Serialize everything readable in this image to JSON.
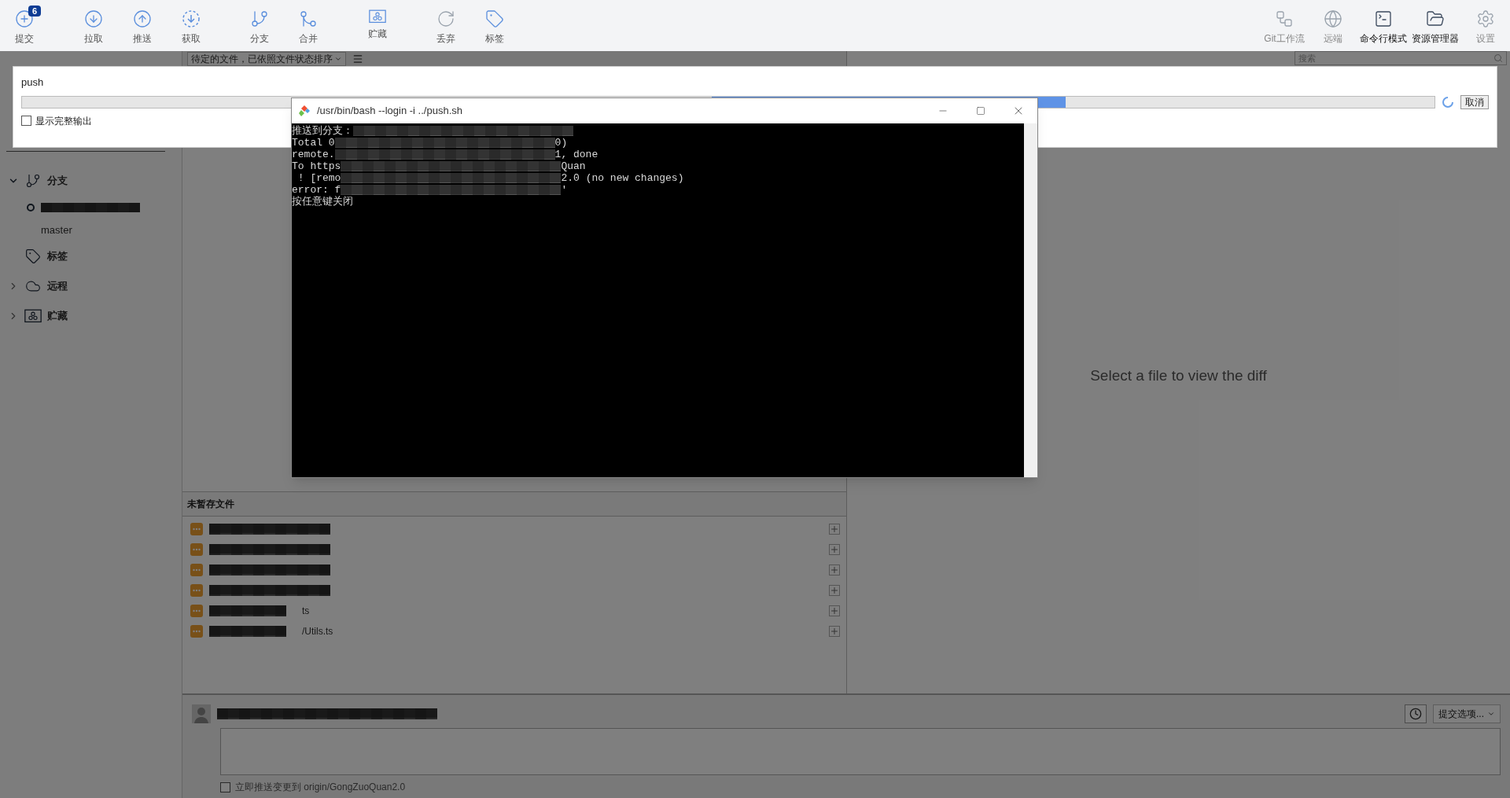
{
  "toolbar": {
    "left": [
      {
        "label": "提交",
        "badge": "6"
      },
      {
        "label": "拉取"
      },
      {
        "label": "推送"
      },
      {
        "label": "获取"
      },
      {
        "label": "分支"
      },
      {
        "label": "合并"
      },
      {
        "label": "贮藏"
      },
      {
        "label": "丢弃"
      },
      {
        "label": "标签"
      }
    ],
    "right": [
      {
        "label": "Git工作流",
        "emphasized": false
      },
      {
        "label": "远端",
        "emphasized": false
      },
      {
        "label": "命令行模式",
        "emphasized": true
      },
      {
        "label": "资源管理器",
        "emphasized": true
      },
      {
        "label": "设置",
        "emphasized": false
      }
    ]
  },
  "file_filter": {
    "label": "待定的文件，已依照文件状态排序",
    "search_placeholder": "搜索"
  },
  "sidebar": {
    "sections": [
      {
        "label": "分支",
        "expanded": true,
        "children": [
          {
            "kind": "redacted",
            "current": true
          },
          {
            "kind": "text",
            "label": "master",
            "current": false
          }
        ]
      },
      {
        "label": "标签"
      },
      {
        "label": "远程",
        "expanded": false
      },
      {
        "label": "贮藏",
        "expanded": false
      }
    ]
  },
  "unstaged": {
    "title": "未暂存文件",
    "files": [
      {
        "kind": "modified"
      },
      {
        "kind": "modified"
      },
      {
        "kind": "modified"
      },
      {
        "kind": "modified"
      },
      {
        "kind": "modified",
        "name_tail": "ts"
      },
      {
        "kind": "modified",
        "name_tail": "/Utils.ts"
      }
    ]
  },
  "diff": {
    "placeholder": "Select a file to view the diff"
  },
  "commit": {
    "options_label": "提交选项...",
    "push_checkbox": {
      "label": "立即推送变更到 origin/GongZuoQuan2.0",
      "checked": false
    }
  },
  "push_dialog": {
    "title": "push",
    "progress": {
      "indeterminate": true
    },
    "show_full_output": {
      "label": "显示完整输出",
      "checked": false
    },
    "cancel": "取消"
  },
  "terminal": {
    "title": "/usr/bin/bash --login -i ../push.sh",
    "lines": [
      {
        "segments": [
          {
            "kind": "text",
            "text": "推送到分支："
          },
          {
            "kind": "redacted"
          }
        ]
      },
      {
        "segments": [
          {
            "kind": "text",
            "text": "Total 0"
          },
          {
            "kind": "redacted"
          },
          {
            "kind": "text",
            "text": "0)"
          }
        ]
      },
      {
        "segments": [
          {
            "kind": "text",
            "text": "remote."
          },
          {
            "kind": "redacted"
          },
          {
            "kind": "text",
            "text": "1, done"
          }
        ]
      },
      {
        "segments": [
          {
            "kind": "text",
            "text": "To https"
          },
          {
            "kind": "redacted"
          },
          {
            "kind": "text",
            "text": "Quan"
          }
        ]
      },
      {
        "segments": [
          {
            "kind": "text",
            "text": " ! [remo"
          },
          {
            "kind": "redacted"
          },
          {
            "kind": "text",
            "text": "2.0 (no new changes)"
          }
        ]
      },
      {
        "segments": [
          {
            "kind": "text",
            "text": "error: f"
          },
          {
            "kind": "redacted"
          },
          {
            "kind": "text",
            "text": "'"
          }
        ]
      },
      {
        "segments": [
          {
            "kind": "text",
            "text": "按任意键关闭"
          }
        ]
      }
    ]
  }
}
